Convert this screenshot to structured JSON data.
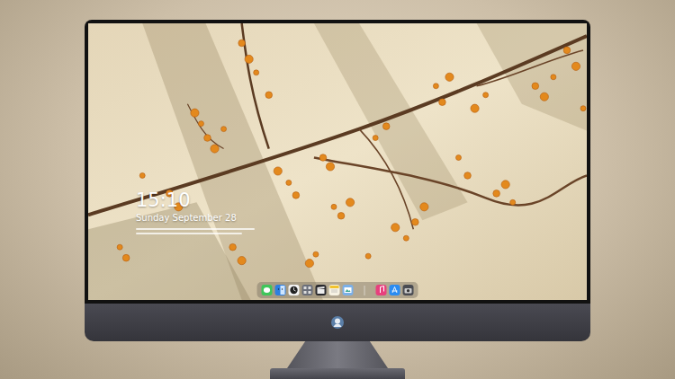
{
  "lock_screen": {
    "time": "15:10",
    "date": "Sunday September 28"
  }
}
